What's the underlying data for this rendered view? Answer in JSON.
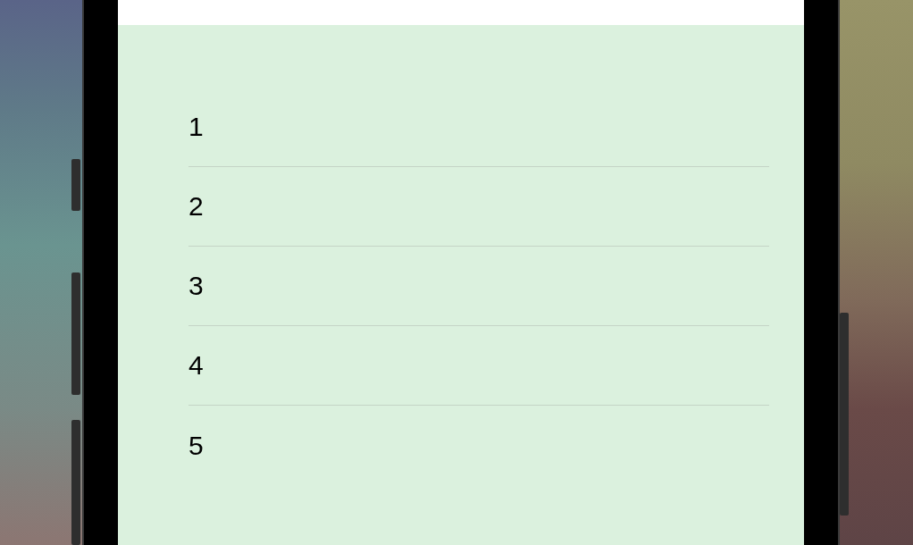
{
  "list": {
    "rows": [
      {
        "label": "1"
      },
      {
        "label": "2"
      },
      {
        "label": "3"
      },
      {
        "label": "4"
      },
      {
        "label": "5"
      }
    ]
  }
}
